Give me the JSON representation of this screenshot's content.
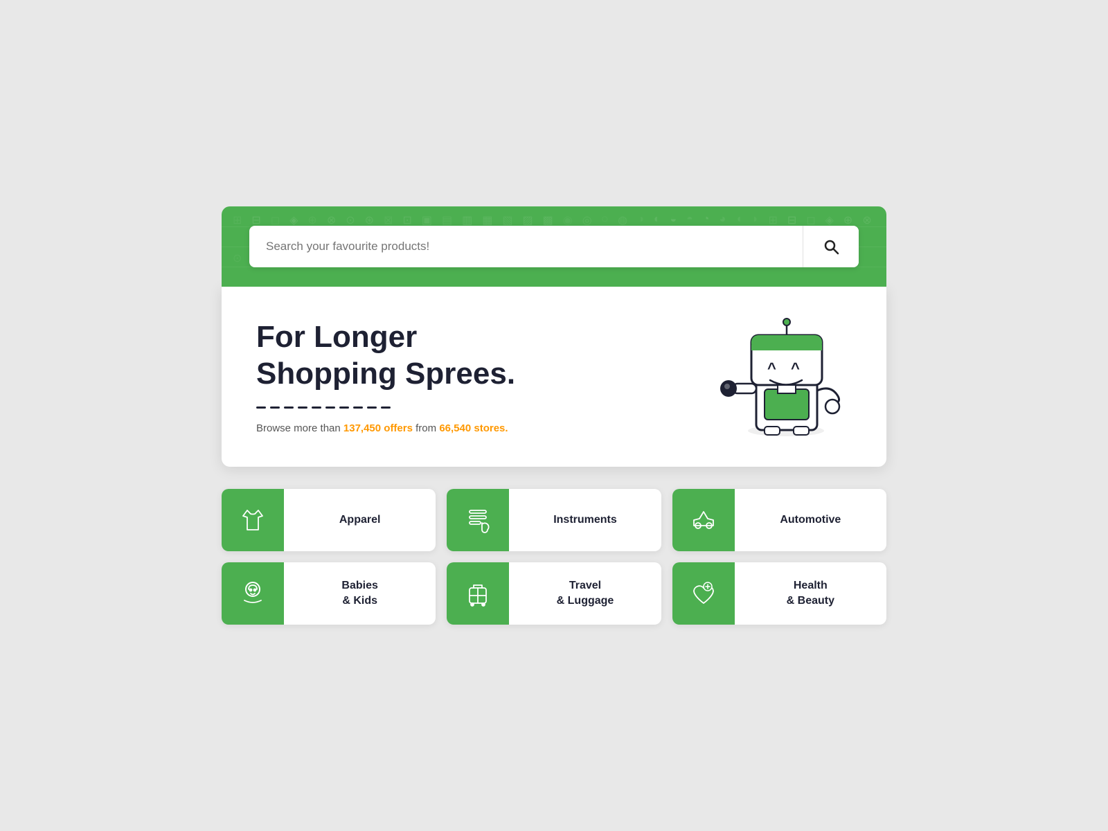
{
  "search": {
    "placeholder": "Search your favourite products!",
    "button_label": "Search"
  },
  "hero": {
    "title_line1": "For Longer",
    "title_line2": "Shopping Sprees.",
    "subtitle_prefix": "Browse more than ",
    "offers": "137,450 offers",
    "subtitle_mid": " from ",
    "stores": "66,540 stores."
  },
  "categories": [
    {
      "id": "apparel",
      "label": "Apparel",
      "icon": "apparel"
    },
    {
      "id": "instruments",
      "label": "Instruments",
      "icon": "instruments"
    },
    {
      "id": "automotive",
      "label": "Automotive",
      "icon": "automotive"
    },
    {
      "id": "babies-kids",
      "label": "Babies\n& Kids",
      "icon": "babies"
    },
    {
      "id": "travel-luggage",
      "label": "Travel\n& Luggage",
      "icon": "travel"
    },
    {
      "id": "health-beauty",
      "label": "Health\n& Beauty",
      "icon": "health"
    }
  ],
  "icon_pattern": [
    "📱",
    "💻",
    "🖥",
    "⌚",
    "🎮",
    "📷",
    "🎧",
    "🛒",
    "👗",
    "🔧",
    "💄",
    "🎵",
    "🚗",
    "👶",
    "✈",
    "🌸"
  ]
}
